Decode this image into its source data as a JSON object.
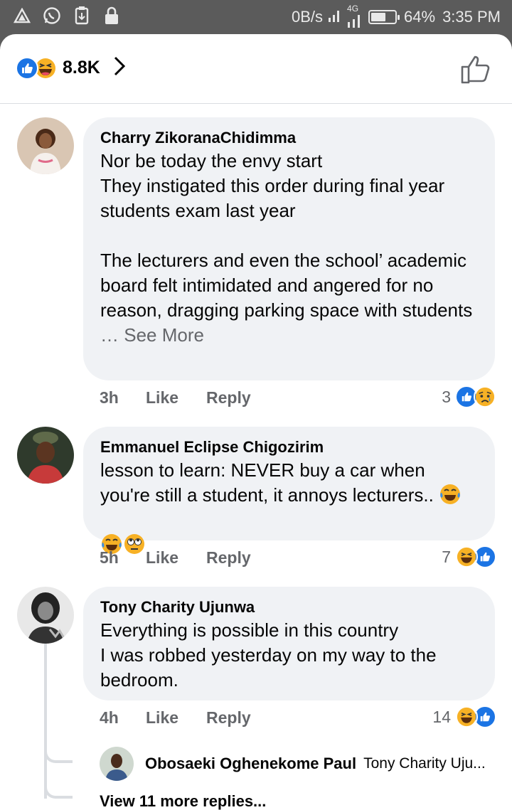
{
  "status_bar": {
    "network_speed": "0B/s",
    "network_type": "4G",
    "battery": "64%",
    "battery_level": 0.64,
    "time": "3:35 PM",
    "icons": [
      "alert-icon",
      "whatsapp-icon",
      "save-icon",
      "lock-icon"
    ]
  },
  "header": {
    "reaction_count": "8.8K",
    "reactions": [
      "like",
      "haha"
    ]
  },
  "comments": [
    {
      "author": "Charry ZikoranaChidimma",
      "text": "Nor be today the envy start\nThey instigated this order during final year students exam last year\n\nThe lecturers and even the school’ academic board felt intimidated and angered for no reason, dragging parking space with students",
      "see_more": "… See More",
      "time": "3h",
      "like_label": "Like",
      "reply_label": "Reply",
      "reaction_count": "3",
      "reactions": [
        "like",
        "sad"
      ]
    },
    {
      "author": "Emmanuel Eclipse Chigozirim",
      "text": "lesson to learn: NEVER buy a car when you're still a student, it annoys lecturers..",
      "time": "5h",
      "like_label": "Like",
      "reply_label": "Reply",
      "reaction_count": "7",
      "reactions": [
        "haha",
        "like"
      ]
    },
    {
      "author": "Tony Charity Ujunwa",
      "text": "Everything is possible in this country\nI was robbed yesterday on my way to the bedroom.",
      "time": "4h",
      "like_label": "Like",
      "reply_label": "Reply",
      "reaction_count": "14",
      "reactions": [
        "haha",
        "like"
      ]
    }
  ],
  "reply_preview": {
    "author": "Obosaeki Oghenekome Paul",
    "snippet": "Tony Charity Uju..."
  },
  "view_more_replies": "View 11 more replies..."
}
